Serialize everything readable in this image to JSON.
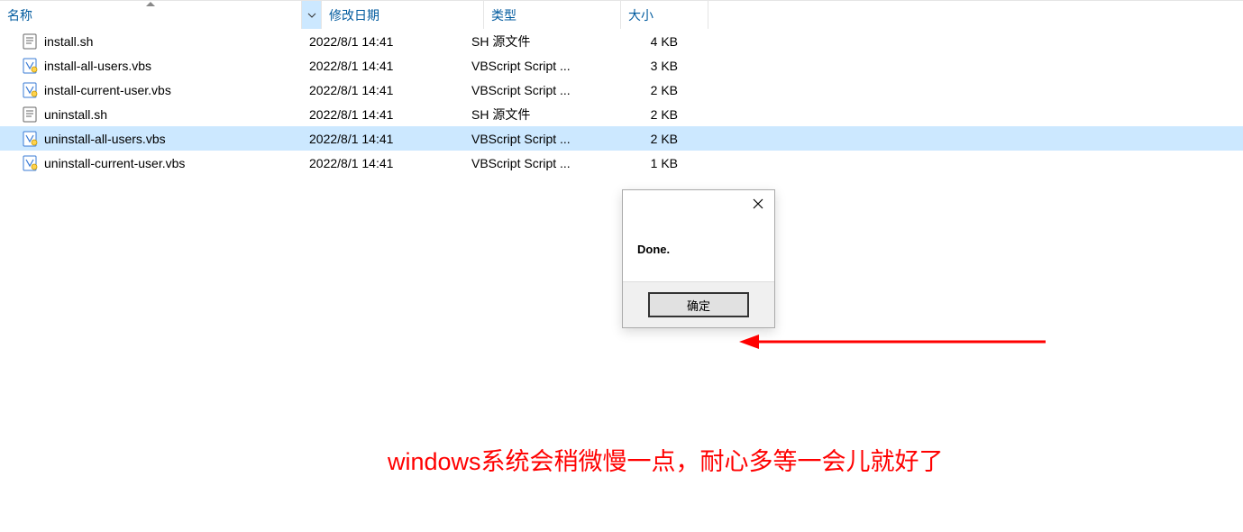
{
  "columns": {
    "name": "名称",
    "date": "修改日期",
    "type": "类型",
    "size": "大小"
  },
  "files": [
    {
      "name": "install.sh",
      "date": "2022/8/1 14:41",
      "type": "SH 源文件",
      "size": "4 KB",
      "iconType": "sh",
      "selected": false
    },
    {
      "name": "install-all-users.vbs",
      "date": "2022/8/1 14:41",
      "type": "VBScript Script ...",
      "size": "3 KB",
      "iconType": "vbs",
      "selected": false
    },
    {
      "name": "install-current-user.vbs",
      "date": "2022/8/1 14:41",
      "type": "VBScript Script ...",
      "size": "2 KB",
      "iconType": "vbs",
      "selected": false
    },
    {
      "name": "uninstall.sh",
      "date": "2022/8/1 14:41",
      "type": "SH 源文件",
      "size": "2 KB",
      "iconType": "sh",
      "selected": false
    },
    {
      "name": "uninstall-all-users.vbs",
      "date": "2022/8/1 14:41",
      "type": "VBScript Script ...",
      "size": "2 KB",
      "iconType": "vbs",
      "selected": true
    },
    {
      "name": "uninstall-current-user.vbs",
      "date": "2022/8/1 14:41",
      "type": "VBScript Script ...",
      "size": "1 KB",
      "iconType": "vbs",
      "selected": false
    }
  ],
  "dialog": {
    "message": "Done.",
    "ok_label": "确定"
  },
  "annotation": "windows系统会稍微慢一点，耐心多等一会儿就好了"
}
